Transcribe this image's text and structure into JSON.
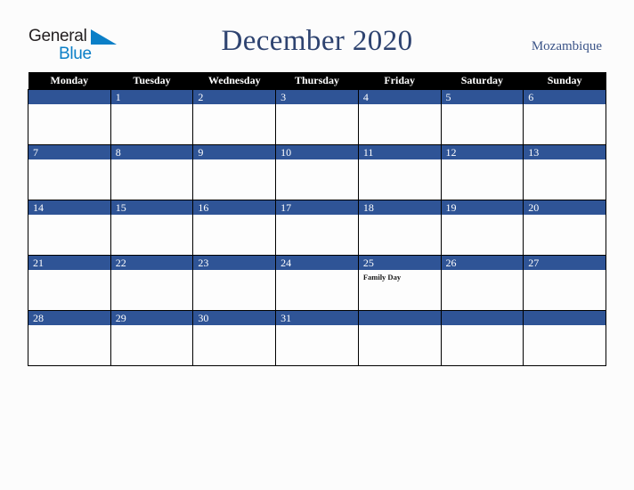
{
  "brand": {
    "name_part1": "General",
    "name_part2": "Blue",
    "triangle_icon": "triangle-icon",
    "accent_color": "#0b7fc7",
    "text_color": "#231f20"
  },
  "header": {
    "title": "December 2020",
    "country": "Mozambique",
    "title_color": "#2e4370",
    "country_color": "#3b5488"
  },
  "calendar": {
    "month": "December",
    "year": "2020",
    "first_day_of_week": "Monday",
    "header_bg": "#000000",
    "header_text": "#ffffff",
    "daynum_bg": "#2f5496",
    "daynum_text": "#ffffff",
    "cell_bg": "#fdfdfd",
    "border_color": "#000000",
    "weekdays": [
      "Monday",
      "Tuesday",
      "Wednesday",
      "Thursday",
      "Friday",
      "Saturday",
      "Sunday"
    ],
    "weeks": [
      [
        {
          "day": "",
          "events": []
        },
        {
          "day": "1",
          "events": []
        },
        {
          "day": "2",
          "events": []
        },
        {
          "day": "3",
          "events": []
        },
        {
          "day": "4",
          "events": []
        },
        {
          "day": "5",
          "events": []
        },
        {
          "day": "6",
          "events": []
        }
      ],
      [
        {
          "day": "7",
          "events": []
        },
        {
          "day": "8",
          "events": []
        },
        {
          "day": "9",
          "events": []
        },
        {
          "day": "10",
          "events": []
        },
        {
          "day": "11",
          "events": []
        },
        {
          "day": "12",
          "events": []
        },
        {
          "day": "13",
          "events": []
        }
      ],
      [
        {
          "day": "14",
          "events": []
        },
        {
          "day": "15",
          "events": []
        },
        {
          "day": "16",
          "events": []
        },
        {
          "day": "17",
          "events": []
        },
        {
          "day": "18",
          "events": []
        },
        {
          "day": "19",
          "events": []
        },
        {
          "day": "20",
          "events": []
        }
      ],
      [
        {
          "day": "21",
          "events": []
        },
        {
          "day": "22",
          "events": []
        },
        {
          "day": "23",
          "events": []
        },
        {
          "day": "24",
          "events": []
        },
        {
          "day": "25",
          "events": [
            "Family Day"
          ]
        },
        {
          "day": "26",
          "events": []
        },
        {
          "day": "27",
          "events": []
        }
      ],
      [
        {
          "day": "28",
          "events": []
        },
        {
          "day": "29",
          "events": []
        },
        {
          "day": "30",
          "events": []
        },
        {
          "day": "31",
          "events": []
        },
        {
          "day": "",
          "events": []
        },
        {
          "day": "",
          "events": []
        },
        {
          "day": "",
          "events": []
        }
      ]
    ]
  }
}
